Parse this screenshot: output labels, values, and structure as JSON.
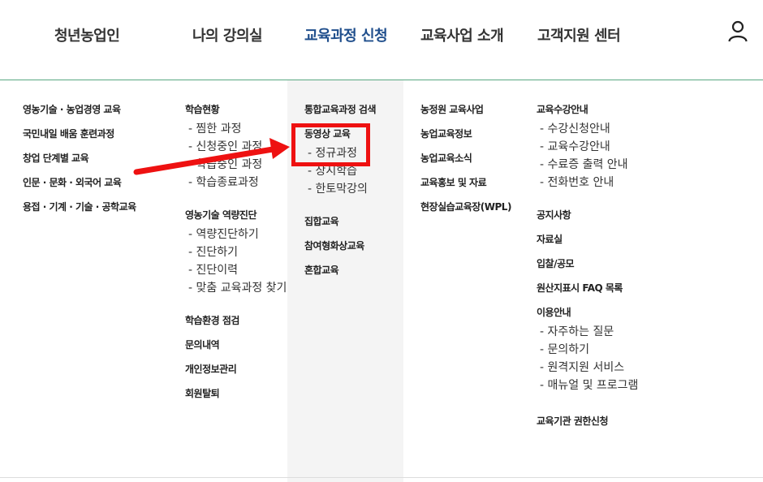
{
  "header": {
    "nav": [
      {
        "label": "청년농업인",
        "active": false
      },
      {
        "label": "나의 강의실",
        "active": false
      },
      {
        "label": "교육과정 신청",
        "active": true
      },
      {
        "label": "교육사업 소개",
        "active": false
      },
      {
        "label": "고객지원 센터",
        "active": false
      }
    ],
    "user_icon": "user-icon"
  },
  "menu": {
    "col1": [
      "영농기술 · 농업경영 교육",
      "국민내일 배움 훈련과정",
      "창업 단계별 교육",
      "인문 · 문화 · 외국어 교육",
      "용접 · 기계 · 기술 · 공학교육"
    ],
    "col2": {
      "g1": {
        "title": "학습현황",
        "items": [
          "- 찜한 과정",
          "- 신청중인 과정",
          "- 학습중인 과정",
          "- 학습종료과정"
        ]
      },
      "g2": {
        "title": "영농기술 역량진단",
        "items": [
          "- 역량진단하기",
          "- 진단하기",
          "- 진단이력",
          "- 맞춤 교육과정 찾기"
        ]
      },
      "g3": [
        "학습환경 점검",
        "문의내역",
        "개인정보관리",
        "회원탈퇴"
      ]
    },
    "col3": {
      "top": "통합교육과정 검색",
      "video": {
        "title": "동영상 교육",
        "items": [
          "- 정규과정",
          "- 상시학습",
          "- 한토막강의"
        ]
      },
      "rest": [
        "집합교육",
        "참여형화상교육",
        "혼합교육"
      ]
    },
    "col4": [
      "농정원 교육사업",
      "농업교육정보",
      "농업교육소식",
      "교육홍보 및 자료",
      "현장실습교육장(WPL)"
    ],
    "col5": {
      "g1": {
        "title": "교육수강안내",
        "items": [
          "- 수강신청안내",
          "- 교육수강안내",
          "- 수료증 출력 안내",
          "- 전화번호 안내"
        ]
      },
      "g2": [
        "공지사항",
        "자료실",
        "입찰/공모",
        "원산지표시 FAQ 목록"
      ],
      "g3": {
        "title": "이용안내",
        "items": [
          "- 자주하는 질문",
          "- 문의하기",
          "- 원격지원 서비스",
          "- 매뉴얼 및 프로그램"
        ]
      },
      "g4": "교육기관 권한신청"
    }
  },
  "annotation": {
    "color": "#ee1111"
  },
  "colors": {
    "active_nav": "#1f4e8c",
    "divider": "#5aa882",
    "panel_bg": "#f4f4f4"
  }
}
